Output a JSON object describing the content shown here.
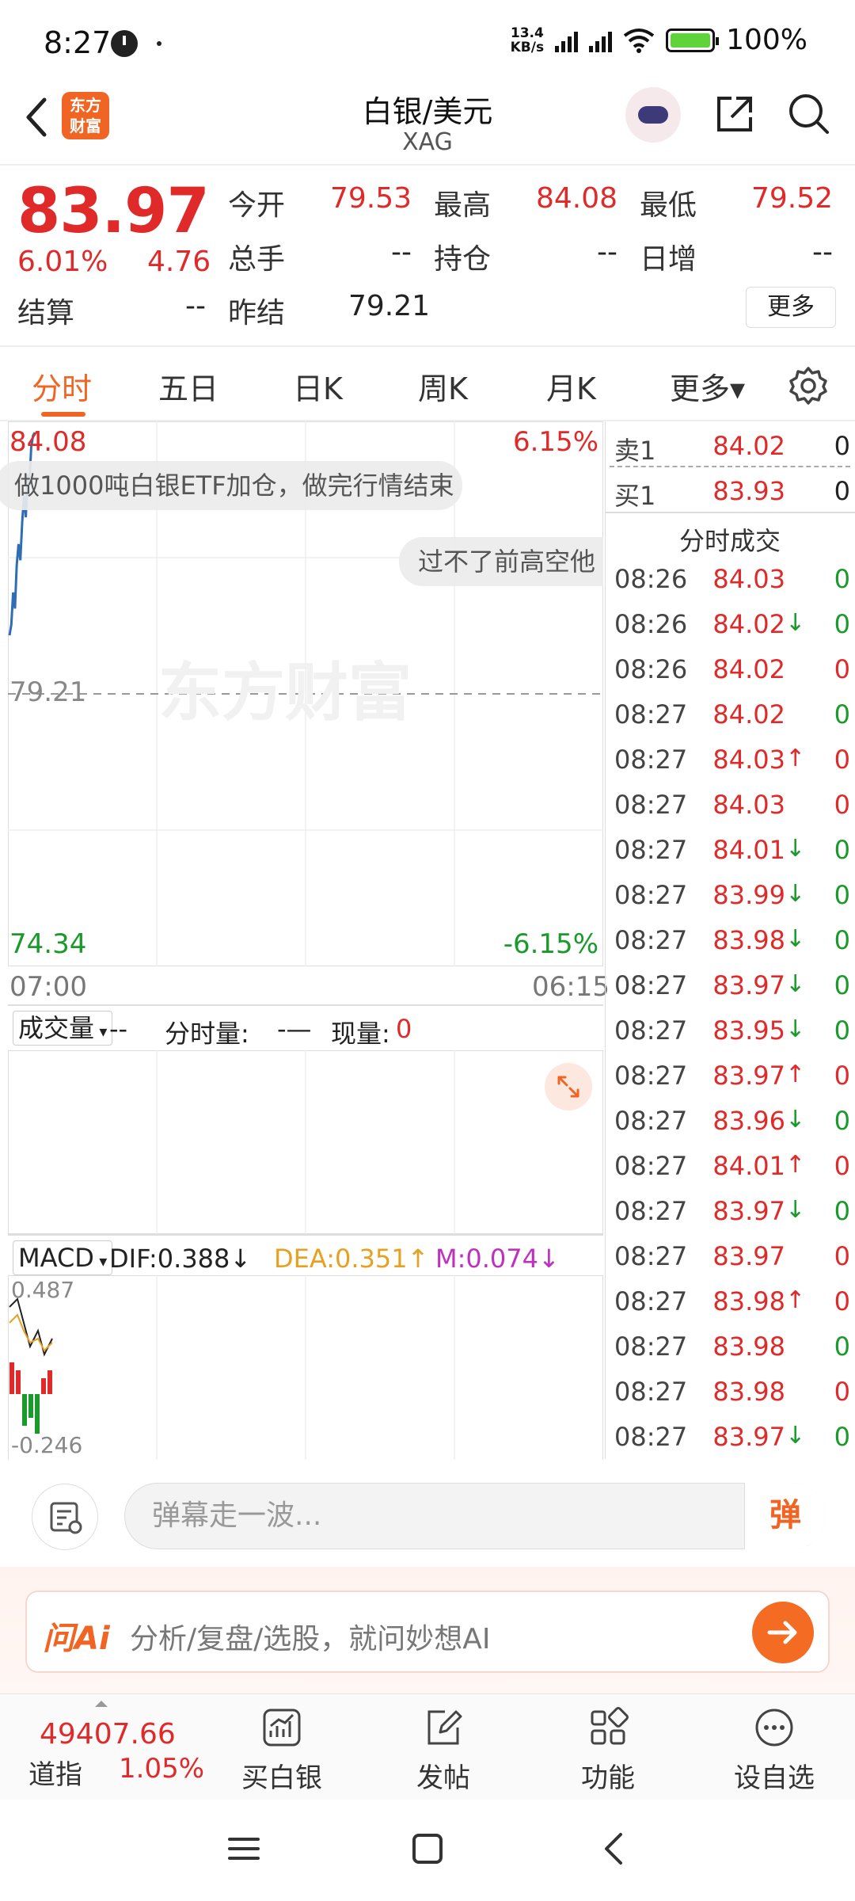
{
  "status_bar": {
    "time": "8:27",
    "net_speed_top": "13.4",
    "net_speed_bottom": "KB/s",
    "battery": "100%"
  },
  "header": {
    "logo_text_1": "东方",
    "logo_text_2": "财富",
    "title": "白银/美元",
    "subtitle": "XAG"
  },
  "quote": {
    "price": "83.97",
    "change_pct": "6.01%",
    "change": "4.76",
    "open_label": "今开",
    "open": "79.53",
    "high_label": "最高",
    "high": "84.08",
    "low_label": "最低",
    "low": "79.52",
    "volume_label": "总手",
    "volume": "--",
    "position_label": "持仓",
    "position": "--",
    "daily_inc_label": "日增",
    "daily_inc": "--",
    "settle_label": "结算",
    "settle": "--",
    "prev_settle_label": "昨结",
    "prev_settle": "79.21",
    "more_button": "更多"
  },
  "tabs": [
    {
      "label": "分时",
      "active": true
    },
    {
      "label": "五日",
      "active": false
    },
    {
      "label": "日K",
      "active": false
    },
    {
      "label": "周K",
      "active": false
    },
    {
      "label": "月K",
      "active": false
    },
    {
      "label": "更多▾",
      "active": false
    }
  ],
  "chart": {
    "y_top": "84.08",
    "y_mid": "79.21",
    "y_bottom": "74.34",
    "pct_top": "6.15%",
    "pct_bottom": "-6.15%",
    "x_start": "07:00",
    "x_end": "06:15",
    "watermark": "东方财富",
    "danmaku_1": "做1000吨白银ETF加仓，做完行情结束",
    "danmaku_2": "过不了前高空他"
  },
  "chart_data": {
    "type": "line",
    "series": [
      {
        "values": [
          80.3,
          80.5,
          81.1,
          80.8,
          81.6,
          82.0,
          81.7,
          82.4,
          82.9,
          82.5,
          83.3,
          83.1,
          83.8,
          84.02,
          84.08
        ]
      }
    ],
    "ylim": [
      74.34,
      84.08
    ],
    "reference_line": 79.21
  },
  "volume": {
    "selector": "成交量",
    "value": "--",
    "tick_label": "分时量:",
    "tick_value": "-—",
    "now_label": "现量:",
    "now_value": "0"
  },
  "macd": {
    "selector": "MACD",
    "dif": "DIF:0.388",
    "dif_arrow": "↓",
    "dea": "DEA:0.351",
    "dea_arrow": "↑",
    "m": "M:0.074",
    "m_arrow": "↓",
    "top": "0.487",
    "bottom": "-0.246"
  },
  "orderbook": {
    "ask_label": "卖1",
    "ask_price": "84.02",
    "ask_qty": "0",
    "bid_label": "买1",
    "bid_price": "83.93",
    "bid_qty": "0",
    "ticks_title": "分时成交"
  },
  "ticks": [
    {
      "time": "08:26",
      "price": "84.03",
      "arrow": "",
      "qty": "0",
      "qty_color": "green"
    },
    {
      "time": "08:26",
      "price": "84.02",
      "arrow": "↓",
      "qty": "0",
      "qty_color": "green"
    },
    {
      "time": "08:26",
      "price": "84.02",
      "arrow": "",
      "qty": "0",
      "qty_color": "red"
    },
    {
      "time": "08:27",
      "price": "84.02",
      "arrow": "",
      "qty": "0",
      "qty_color": "green"
    },
    {
      "time": "08:27",
      "price": "84.03",
      "arrow": "↑",
      "qty": "0",
      "qty_color": "red"
    },
    {
      "time": "08:27",
      "price": "84.03",
      "arrow": "",
      "qty": "0",
      "qty_color": "red"
    },
    {
      "time": "08:27",
      "price": "84.01",
      "arrow": "↓",
      "qty": "0",
      "qty_color": "green"
    },
    {
      "time": "08:27",
      "price": "83.99",
      "arrow": "↓",
      "qty": "0",
      "qty_color": "green"
    },
    {
      "time": "08:27",
      "price": "83.98",
      "arrow": "↓",
      "qty": "0",
      "qty_color": "green"
    },
    {
      "time": "08:27",
      "price": "83.97",
      "arrow": "↓",
      "qty": "0",
      "qty_color": "green"
    },
    {
      "time": "08:27",
      "price": "83.95",
      "arrow": "↓",
      "qty": "0",
      "qty_color": "green"
    },
    {
      "time": "08:27",
      "price": "83.97",
      "arrow": "↑",
      "qty": "0",
      "qty_color": "red"
    },
    {
      "time": "08:27",
      "price": "83.96",
      "arrow": "↓",
      "qty": "0",
      "qty_color": "green"
    },
    {
      "time": "08:27",
      "price": "84.01",
      "arrow": "↑",
      "qty": "0",
      "qty_color": "red"
    },
    {
      "time": "08:27",
      "price": "83.97",
      "arrow": "↓",
      "qty": "0",
      "qty_color": "green"
    },
    {
      "time": "08:27",
      "price": "83.97",
      "arrow": "",
      "qty": "0",
      "qty_color": "red"
    },
    {
      "time": "08:27",
      "price": "83.98",
      "arrow": "↑",
      "qty": "0",
      "qty_color": "red"
    },
    {
      "time": "08:27",
      "price": "83.98",
      "arrow": "",
      "qty": "0",
      "qty_color": "green"
    },
    {
      "time": "08:27",
      "price": "83.98",
      "arrow": "",
      "qty": "0",
      "qty_color": "red"
    },
    {
      "time": "08:27",
      "price": "83.97",
      "arrow": "↓",
      "qty": "0",
      "qty_color": "green"
    }
  ],
  "danmaku_bar": {
    "placeholder": "弹幕走一波...",
    "button": "弹"
  },
  "ai_bar": {
    "logo": "问Ai",
    "text": "分析/复盘/选股，就问妙想AI"
  },
  "toolbar": {
    "dow_value": "49407.66",
    "dow_name": "道指",
    "dow_pct": "1.05%",
    "buy": "买白银",
    "post": "发帖",
    "functions": "功能",
    "watchlist": "设自选"
  },
  "colors": {
    "accent": "#f06524",
    "up": "#e02a2a",
    "down": "#1a9a2a",
    "line": "#2f6db5"
  }
}
